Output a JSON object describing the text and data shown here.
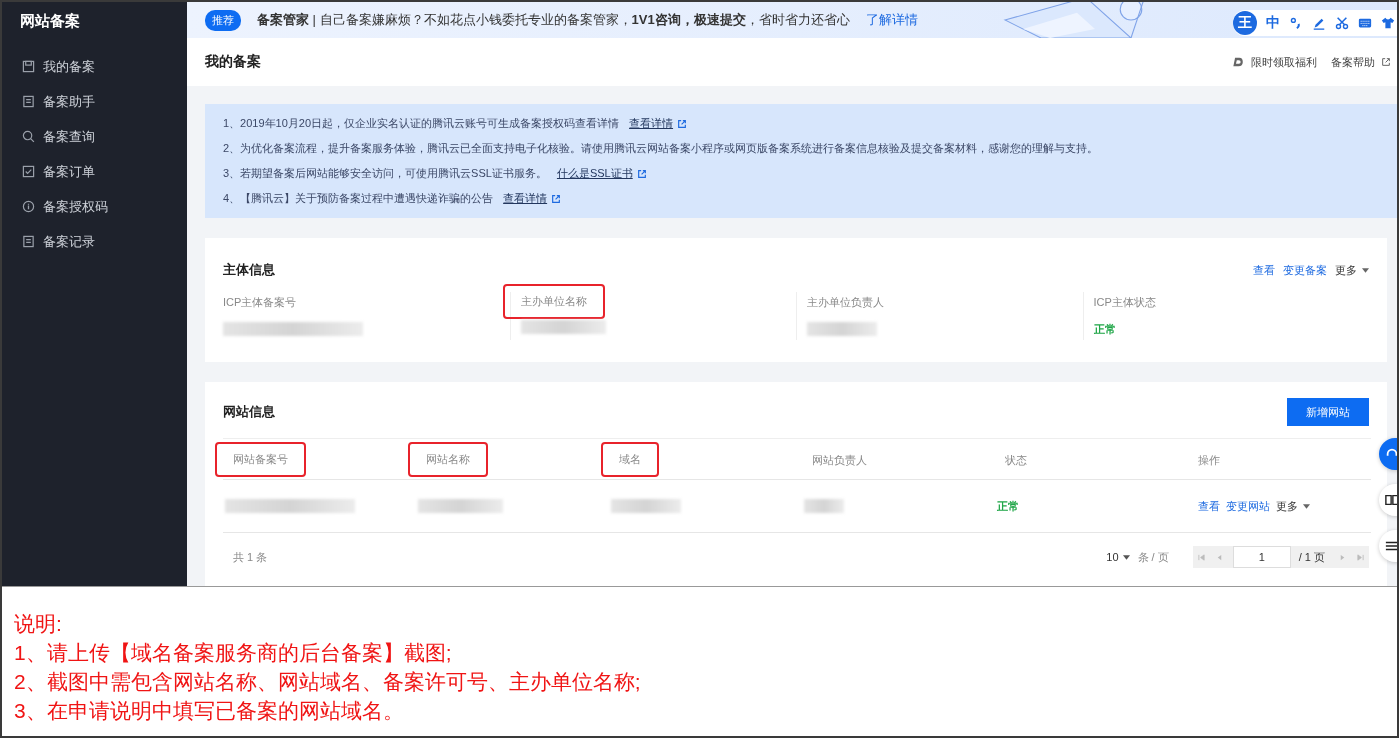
{
  "sidebar": {
    "title": "网站备案",
    "items": [
      {
        "label": "我的备案",
        "kind": "save"
      },
      {
        "label": "备案助手",
        "kind": "doc"
      },
      {
        "label": "备案查询",
        "kind": "search"
      },
      {
        "label": "备案订单",
        "kind": "check"
      },
      {
        "label": "备案授权码",
        "kind": "info"
      },
      {
        "label": "备案记录",
        "kind": "doc"
      }
    ]
  },
  "banner": {
    "tag": "推荐",
    "text": "**备案管家** | 自己备案嫌麻烦？不如花点小钱委托专业的备案管家，**1V1咨询，极速提交**，省时省力还省心",
    "link": "了解详情"
  },
  "ime_toolbar": {
    "logo": "王",
    "mode": "中"
  },
  "header": {
    "title": "我的备案",
    "links": [
      {
        "label": "限时领取福利",
        "kind": "gift"
      },
      {
        "label": "备案帮助",
        "kind": "external"
      }
    ]
  },
  "notices": [
    {
      "text": "1、2019年10月20日起，仅企业实名认证的腾讯云账号可生成备案授权码查看详情",
      "link": "查看详情"
    },
    {
      "text": "2、为优化备案流程，提升备案服务体验，腾讯云已全面支持电子化核验。请使用腾讯云网站备案小程序或网页版备案系统进行备案信息核验及提交备案材料，感谢您的理解与支持。"
    },
    {
      "text": "3、若期望备案后网站能够安全访问，可使用腾讯云SSL证书服务。",
      "link": "什么是SSL证书"
    },
    {
      "text": "4、【腾讯云】关于预防备案过程中遭遇快递诈骗的公告",
      "link": "查看详情"
    }
  ],
  "subject_card": {
    "title": "主体信息",
    "actions": [
      {
        "label": "查看",
        "kind": "link"
      },
      {
        "label": "变更备案",
        "kind": "link"
      },
      {
        "label": "更多",
        "kind": "menu"
      }
    ],
    "fields": [
      {
        "label": "ICP主体备案号",
        "highlighted": false
      },
      {
        "label": "主办单位名称",
        "highlighted": true
      },
      {
        "label": "主办单位负责人",
        "highlighted": false
      },
      {
        "label": "ICP主体状态",
        "highlighted": false,
        "value": "正常"
      }
    ]
  },
  "website_card": {
    "title": "网站信息",
    "add_button": "新增网站",
    "columns": [
      {
        "label": "网站备案号",
        "highlighted": true
      },
      {
        "label": "网站名称",
        "highlighted": true
      },
      {
        "label": "域名",
        "highlighted": true
      },
      {
        "label": "网站负责人",
        "highlighted": false
      },
      {
        "label": "状态",
        "highlighted": false
      },
      {
        "label": "操作",
        "highlighted": false
      }
    ],
    "rows": [
      {
        "cells": [
          {
            "kind": "blurred"
          },
          {
            "kind": "blurred"
          },
          {
            "kind": "blurred"
          },
          {
            "kind": "blurred"
          },
          {
            "kind": "status",
            "text": "正常"
          },
          {
            "kind": "actions",
            "actions": [
              {
                "label": "查看",
                "kind": "link"
              },
              {
                "label": "变更网站",
                "kind": "link"
              },
              {
                "label": "更多",
                "kind": "menu"
              }
            ]
          }
        ]
      }
    ],
    "pagination": {
      "total": "共 1 条",
      "page_size": "10",
      "per_page": "条 / 页",
      "page": "1",
      "pages": "/ 1 页"
    }
  },
  "note": {
    "lines": [
      "说明:",
      "1、请上传【域名备案服务商的后台备案】截图;",
      "2、截图中需包含网站名称、网站域名、备案许可号、主办单位名称;",
      "3、在申请说明中填写已备案的网站域名。"
    ]
  }
}
